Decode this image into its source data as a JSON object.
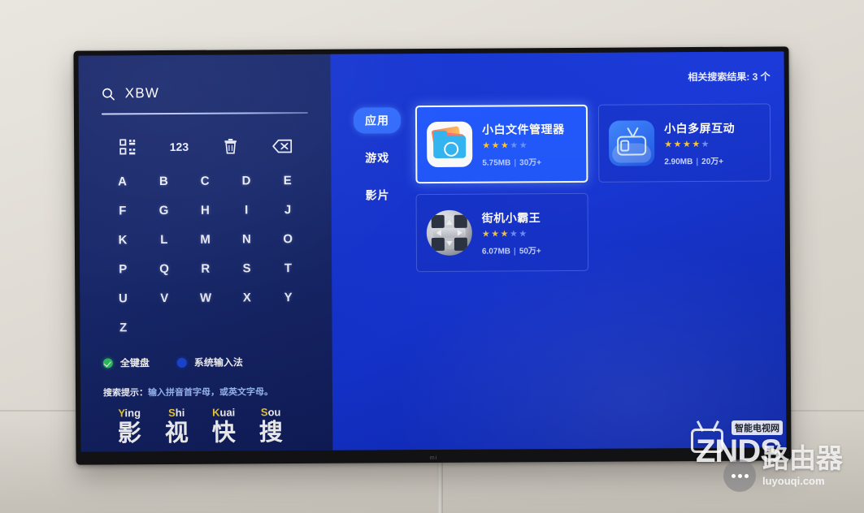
{
  "device": {
    "brand_logo": "mi"
  },
  "search": {
    "icon": "search-icon",
    "query": "XBW",
    "placeholder": "XBW"
  },
  "keyboard": {
    "tools": [
      {
        "name": "qr-keyboard-icon",
        "label": "██"
      },
      {
        "name": "numeric-mode-button",
        "label": "123"
      },
      {
        "name": "clear-icon",
        "label": "█"
      },
      {
        "name": "backspace-icon",
        "label": "█"
      }
    ],
    "numeric_label": "123",
    "keys": [
      "A",
      "B",
      "C",
      "D",
      "E",
      "F",
      "G",
      "H",
      "I",
      "J",
      "K",
      "L",
      "M",
      "N",
      "O",
      "P",
      "Q",
      "R",
      "S",
      "T",
      "U",
      "V",
      "W",
      "X",
      "Y",
      "Z"
    ]
  },
  "input_method": {
    "options": [
      {
        "label": "全键盘",
        "selected": true,
        "color": "#2fc464"
      },
      {
        "label": "系统输入法",
        "selected": false,
        "color": "#1a46d8"
      }
    ]
  },
  "hint": {
    "label": "搜索提示：",
    "body": "输入拼音首字母，或英文字母。",
    "example": [
      {
        "initial": "Y",
        "rest": "ing",
        "han": "影"
      },
      {
        "initial": "S",
        "rest": "hi",
        "han": "视"
      },
      {
        "initial": "K",
        "rest": "uai",
        "han": "快"
      },
      {
        "initial": "S",
        "rest": "ou",
        "han": "搜"
      }
    ]
  },
  "results": {
    "count_text": "相关搜索结果: 3 个",
    "categories": [
      {
        "label": "应用",
        "active": true
      },
      {
        "label": "游戏",
        "active": false
      },
      {
        "label": "影片",
        "active": false
      }
    ],
    "apps": [
      {
        "name": "小白文件管理器",
        "icon": "file-manager-icon",
        "stars_on": 3,
        "stars_total": 5,
        "size": "5.75MB",
        "downloads": "30万+",
        "separator": "|",
        "selected": true
      },
      {
        "name": "小白多屏互动",
        "icon": "multiscreen-tv-icon",
        "stars_on": 4,
        "stars_total": 5,
        "size": "2.90MB",
        "downloads": "20万+",
        "separator": "|",
        "selected": false
      },
      {
        "name": "街机小霸王",
        "icon": "gamepad-icon",
        "stars_on": 3,
        "stars_total": 5,
        "size": "6.07MB",
        "downloads": "50万+",
        "separator": "|",
        "selected": false
      }
    ]
  },
  "watermarks": {
    "znds": {
      "text": "ZNDS",
      "sub": "智能电视网"
    },
    "luyouqi": {
      "cn": "路由器",
      "url": "luyouqi.com"
    }
  },
  "colors": {
    "left_panel": "#16276e",
    "right_panel": "#1434d8",
    "accent": "#2f6bff",
    "star_on": "#ffc832",
    "star_off": "#6e92ff",
    "radio_on": "#2fc464",
    "pinyin_initial": "#f3d03e"
  }
}
